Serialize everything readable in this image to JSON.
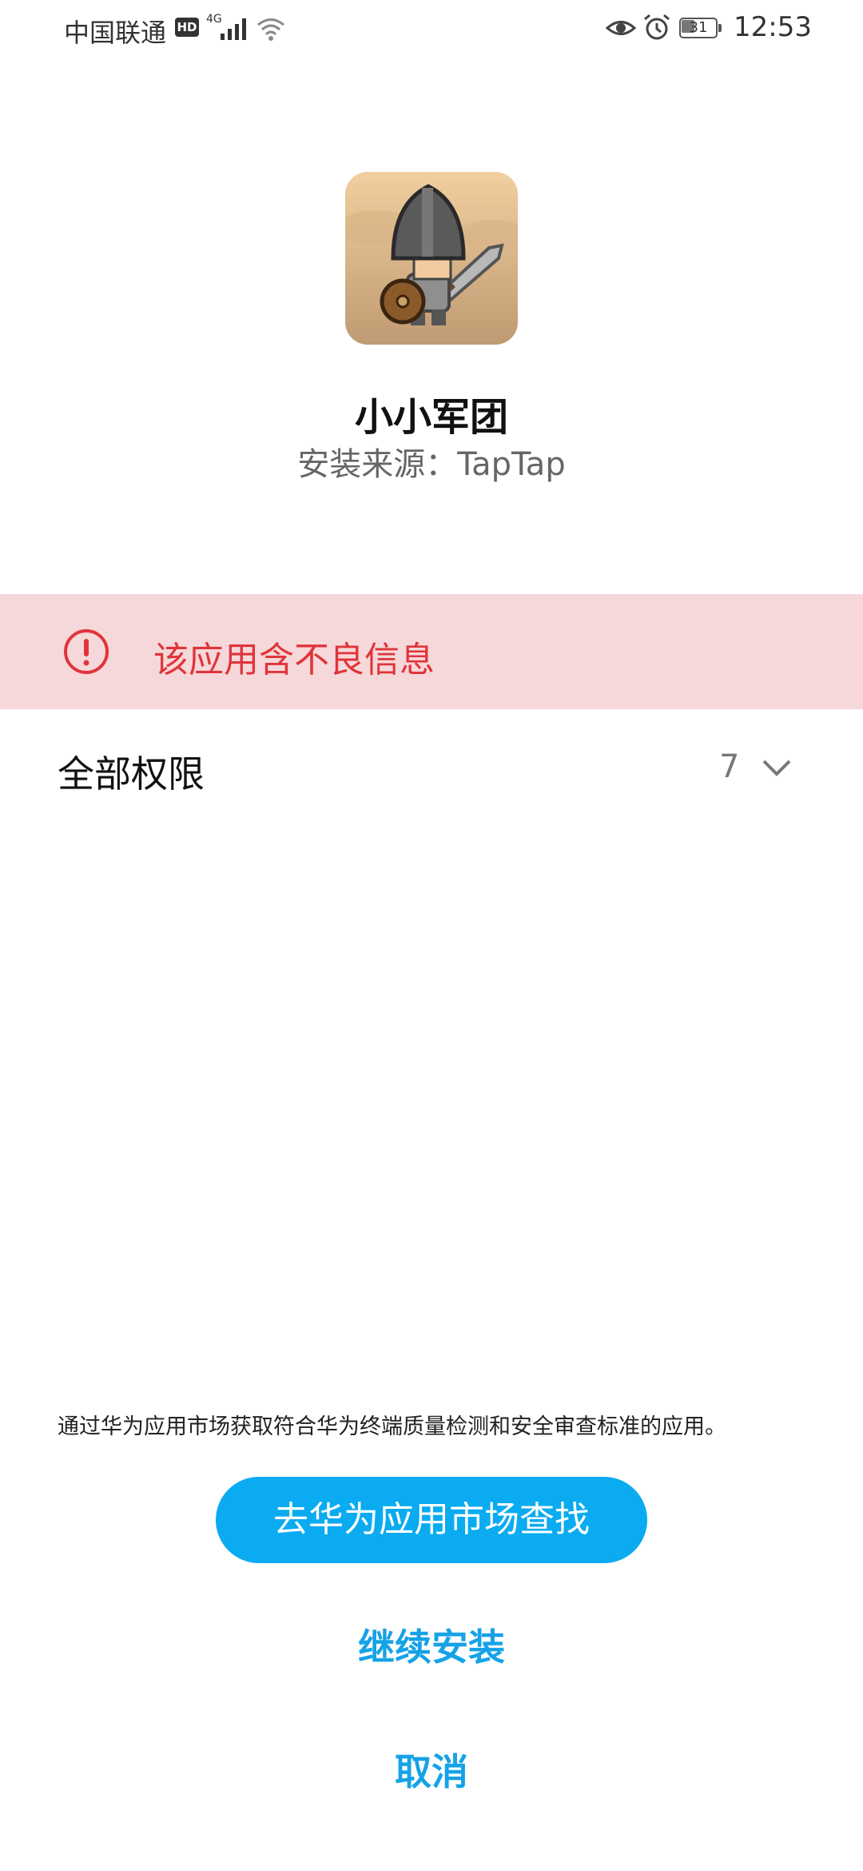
{
  "status_bar": {
    "carrier": "中国联通",
    "hd_badge": "HD",
    "network_type": "4G",
    "battery_level": "31",
    "time": "12:53",
    "icons": [
      "signal-icon",
      "wifi-icon",
      "eye-icon",
      "alarm-icon",
      "battery-icon"
    ]
  },
  "app": {
    "name": "小小军团",
    "install_source": "安装来源：TapTap",
    "icon": "knight-game-icon"
  },
  "warning": {
    "icon": "exclamation-circle-icon",
    "text": "该应用含不良信息",
    "color": "#e0343a",
    "background": "#f6d8da"
  },
  "permissions": {
    "label": "全部权限",
    "count": "7",
    "icon": "chevron-down-icon"
  },
  "footer": {
    "note": "通过华为应用市场获取符合华为终端质量检测和安全审查标准的应用。",
    "market_button": "去华为应用市场查找",
    "continue_button": "继续安装",
    "cancel_button": "取消",
    "accent_color": "#0aabf0"
  }
}
